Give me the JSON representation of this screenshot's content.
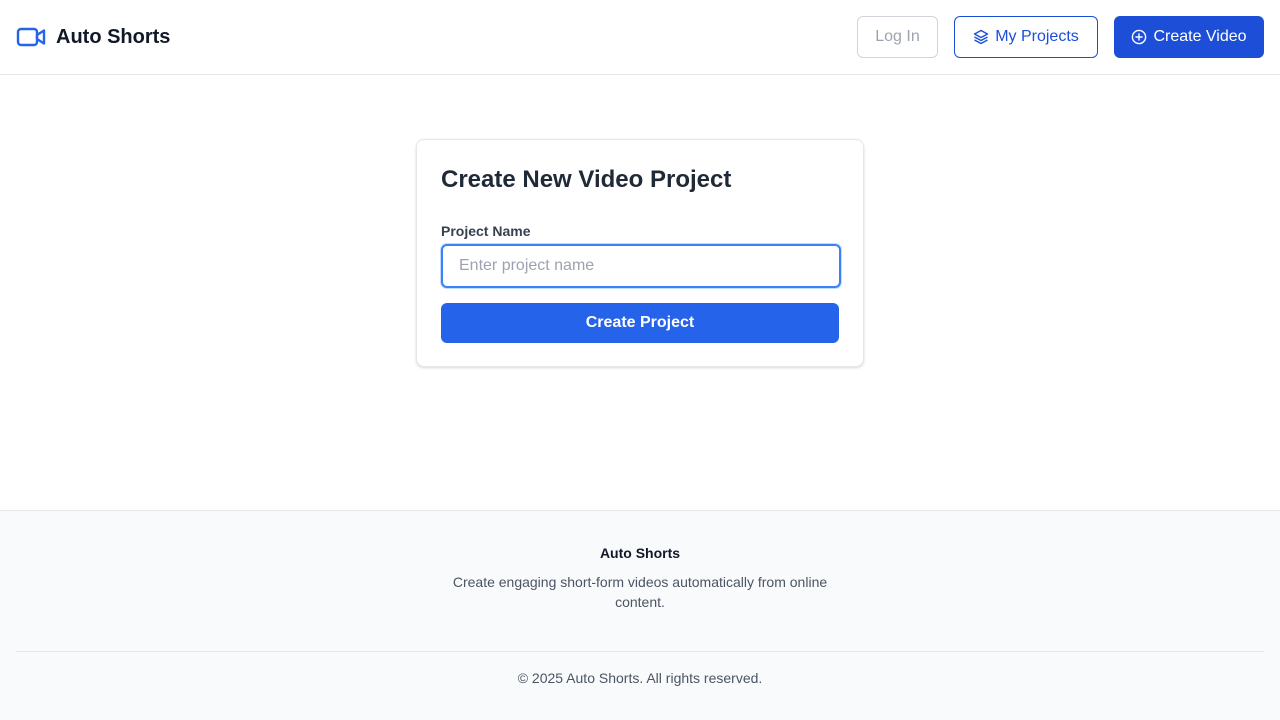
{
  "header": {
    "brand_name": "Auto Shorts",
    "brand_icon": "video-camera-icon",
    "login_label": "Log In",
    "projects_label": "My Projects",
    "projects_icon": "layers-icon",
    "create_label": "Create Video",
    "create_icon": "plus-circle-icon"
  },
  "card": {
    "title": "Create New Video Project",
    "field_label": "Project Name",
    "input_value": "",
    "input_placeholder": "Enter project name",
    "submit_label": "Create Project"
  },
  "footer": {
    "brand": "Auto Shorts",
    "description": "Create engaging short-form videos automatically from online content.",
    "copyright": "© 2025 Auto Shorts. All rights reserved."
  },
  "colors": {
    "primary": "#2563eb",
    "primary_dark": "#1d4ed8",
    "focus_ring": "#3b82f6",
    "muted_text": "#9ca3af",
    "footer_bg": "#f9fafb"
  }
}
